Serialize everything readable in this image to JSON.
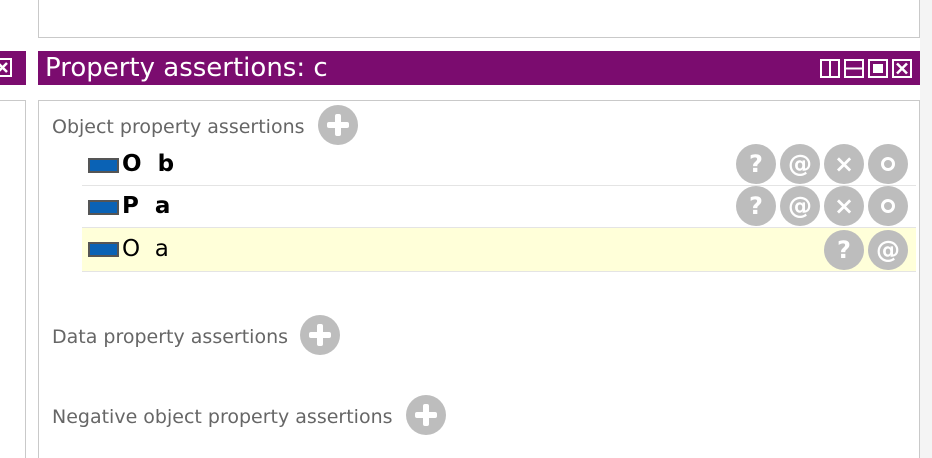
{
  "view": {
    "title": "Property assertions: c",
    "header_color": "#7b0c6f",
    "window_buttons": [
      "split-vertical-icon",
      "split-horizontal-icon",
      "maximize-icon",
      "close-icon"
    ]
  },
  "sections": {
    "object": {
      "label": "Object property assertions",
      "rows": [
        {
          "text": "O  b",
          "bold": true,
          "highlighted": false,
          "actions": [
            "?",
            "@",
            "×",
            "o"
          ]
        },
        {
          "text": "P  a",
          "bold": true,
          "highlighted": false,
          "actions": [
            "?",
            "@",
            "×",
            "o"
          ]
        },
        {
          "text": "O  a",
          "bold": false,
          "highlighted": true,
          "actions": [
            "?",
            "@"
          ]
        }
      ]
    },
    "data": {
      "label": "Data property assertions"
    },
    "negative": {
      "label": "Negative object property assertions"
    }
  },
  "colors": {
    "icon_fill": "#0a62b5",
    "button_gray": "#bdbdbd",
    "highlight": "#ffffd9",
    "label_gray": "#666666"
  }
}
